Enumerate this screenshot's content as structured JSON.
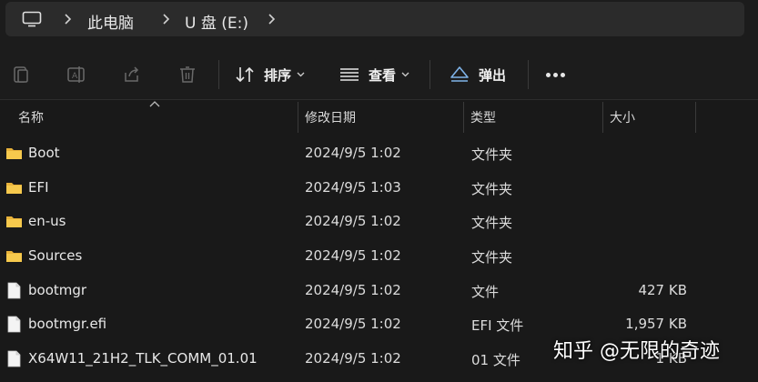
{
  "address_bar": {
    "crumbs": [
      "此电脑",
      "U 盘 (E:)"
    ]
  },
  "toolbar": {
    "sort_label": "排序",
    "view_label": "查看",
    "eject_label": "弹出"
  },
  "columns": {
    "name": "名称",
    "date": "修改日期",
    "type": "类型",
    "size": "大小"
  },
  "files": [
    {
      "name": "Boot",
      "date": "2024/9/5 1:02",
      "type": "文件夹",
      "size": "",
      "kind": "folder"
    },
    {
      "name": "EFI",
      "date": "2024/9/5 1:03",
      "type": "文件夹",
      "size": "",
      "kind": "folder"
    },
    {
      "name": "en-us",
      "date": "2024/9/5 1:02",
      "type": "文件夹",
      "size": "",
      "kind": "folder"
    },
    {
      "name": "Sources",
      "date": "2024/9/5 1:02",
      "type": "文件夹",
      "size": "",
      "kind": "folder"
    },
    {
      "name": "bootmgr",
      "date": "2024/9/5 1:02",
      "type": "文件",
      "size": "427 KB",
      "kind": "file"
    },
    {
      "name": "bootmgr.efi",
      "date": "2024/9/5 1:02",
      "type": "EFI 文件",
      "size": "1,957 KB",
      "kind": "file"
    },
    {
      "name": "X64W11_21H2_TLK_COMM_01.01",
      "date": "2024/9/5 1:02",
      "type": "01 文件",
      "size": "1 KB",
      "kind": "file"
    }
  ],
  "watermark": "知乎 @无限的奇迹",
  "colors": {
    "background": "#191919",
    "folder": "#f3c242",
    "accent": "#7fb3e8"
  }
}
